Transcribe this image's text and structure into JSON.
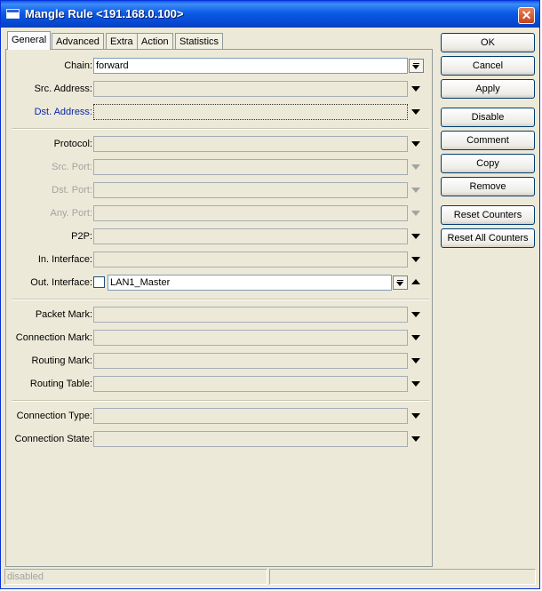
{
  "window": {
    "title": "Mangle Rule <191.168.0.100>",
    "close_symbol": "✕"
  },
  "tabs": [
    "General",
    "Advanced",
    "Extra",
    "Action",
    "Statistics"
  ],
  "fields": {
    "chain": {
      "label": "Chain:",
      "value": "forward"
    },
    "src_address": {
      "label": "Src. Address:"
    },
    "dst_address": {
      "label": "Dst. Address:"
    },
    "protocol": {
      "label": "Protocol:"
    },
    "src_port": {
      "label": "Src. Port:"
    },
    "dst_port": {
      "label": "Dst. Port:"
    },
    "any_port": {
      "label": "Any. Port:"
    },
    "p2p": {
      "label": "P2P:"
    },
    "in_interface": {
      "label": "In. Interface:"
    },
    "out_interface": {
      "label": "Out. Interface:",
      "value": "LAN1_Master"
    },
    "packet_mark": {
      "label": "Packet Mark:"
    },
    "connection_mark": {
      "label": "Connection Mark:"
    },
    "routing_mark": {
      "label": "Routing Mark:"
    },
    "routing_table": {
      "label": "Routing Table:"
    },
    "connection_type": {
      "label": "Connection Type:"
    },
    "connection_state": {
      "label": "Connection State:"
    }
  },
  "buttons": {
    "ok": "OK",
    "cancel": "Cancel",
    "apply": "Apply",
    "disable": "Disable",
    "comment": "Comment",
    "copy": "Copy",
    "remove": "Remove",
    "reset_counters": "Reset Counters",
    "reset_all_counters": "Reset All Counters"
  },
  "status": {
    "text": "disabled"
  }
}
